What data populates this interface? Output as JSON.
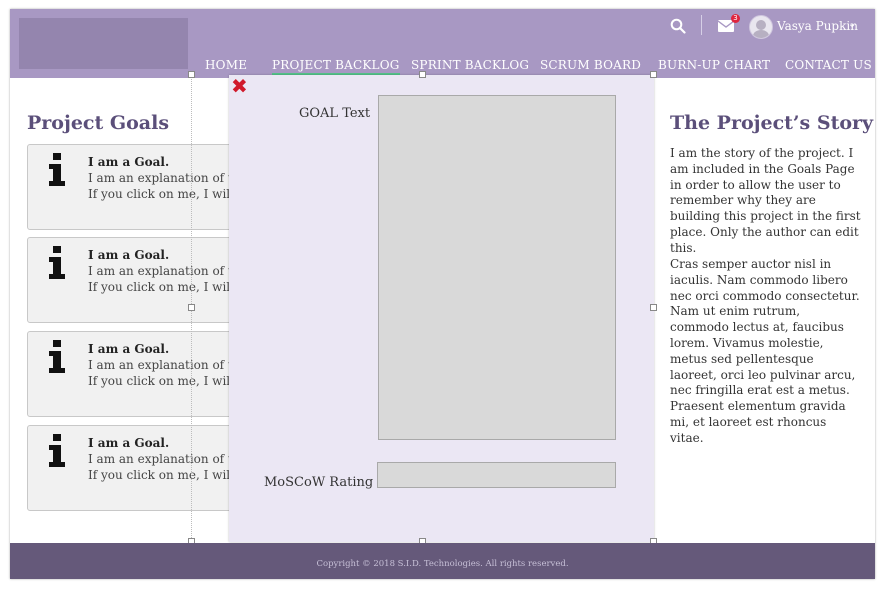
{
  "header": {
    "nav": [
      {
        "label": "HOME"
      },
      {
        "label": "PROJECT BACKLOG"
      },
      {
        "label": "SPRINT BACKLOG"
      },
      {
        "label": "SCRUM BOARD"
      },
      {
        "label": "BURN-UP CHART"
      },
      {
        "label": "CONTACT US"
      }
    ],
    "active_nav": "PROJECT BACKLOG",
    "user": {
      "name": "Vasya Pupkin",
      "notification_count": "3",
      "icons": [
        "search-icon",
        "mail-icon",
        "avatar",
        "chevron-down-icon"
      ]
    }
  },
  "goals": {
    "title": "Project Goals",
    "items": [
      {
        "heading": "I am a Goal.",
        "line1": "I am an explanation of th",
        "line2": "If you click on me, I will"
      },
      {
        "heading": "I am a Goal.",
        "line1": "I am an explanation of th",
        "line2": "If you click on me, I will"
      },
      {
        "heading": "I am a Goal.",
        "line1": "I am an explanation of th",
        "line2": "If you click on me, I will"
      },
      {
        "heading": "I am a Goal.",
        "line1": "I am an explanation of th",
        "line2": "If you click on me, I will"
      }
    ]
  },
  "story": {
    "title": "The Project’s Story",
    "p1": "I am the story of the project. I am included in the Goals Page in order to allow the user to remember why they are building this project in the first place. Only the author can edit this.",
    "p2": "Cras semper auctor nisl in iaculis. Nam commodo libero nec orci commodo consectetur. Nam ut enim rutrum, commodo lectus at, faucibus lorem. Vivamus molestie, metus sed pellentesque laoreet, orci leo pulvinar arcu, nec fringilla erat est a metus. Praesent elementum gravida mi, et laoreet est rhoncus vitae."
  },
  "modal": {
    "goal_label": "GOAL Text",
    "goal_value": "",
    "moscow_label": "MoSCoW Rating",
    "moscow_value": ""
  },
  "footer": {
    "copyright": "Copyright © 2018 S.I.D. Technologies. All rights reserved."
  },
  "colors": {
    "header": "#a898c3",
    "footer": "#65597a",
    "title": "#5b4f7a",
    "modal": "#ebe7f4",
    "active_underline": "#55c28a",
    "close": "#d0192b"
  }
}
